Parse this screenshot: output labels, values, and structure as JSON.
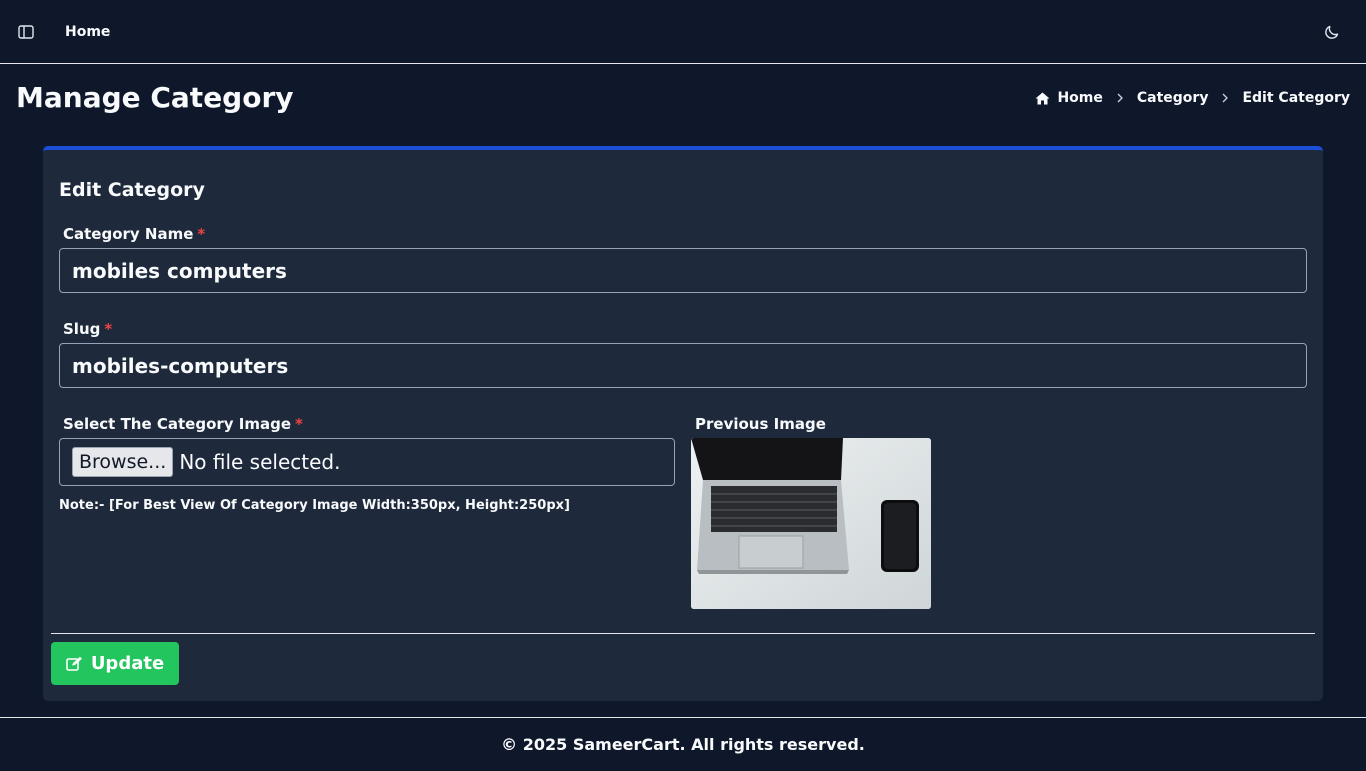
{
  "topbar": {
    "sidebar_toggle_icon": "sidebar-toggle-icon",
    "nav_home": "Home",
    "theme_toggle_icon": "moon-icon"
  },
  "page": {
    "title": "Manage Category"
  },
  "breadcrumb": {
    "home": "Home",
    "category": "Category",
    "current": "Edit Category"
  },
  "card": {
    "title": "Edit Category",
    "accent_color": "#1d4ed8"
  },
  "form": {
    "name_label": "Category Name",
    "name_value": "mobiles computers",
    "slug_label": "Slug",
    "slug_value": "mobiles-computers",
    "image_label": "Select The Category Image",
    "required_mark": "*",
    "browse_label": "Browse...",
    "file_status": "No file selected.",
    "note": "Note:- [For Best View Of Category Image Width:350px, Height:250px]",
    "previous_image_label": "Previous Image",
    "update_label": "Update",
    "update_color": "#22c55e"
  },
  "footer": {
    "text": "© 2025 SameerCart. All rights reserved."
  }
}
